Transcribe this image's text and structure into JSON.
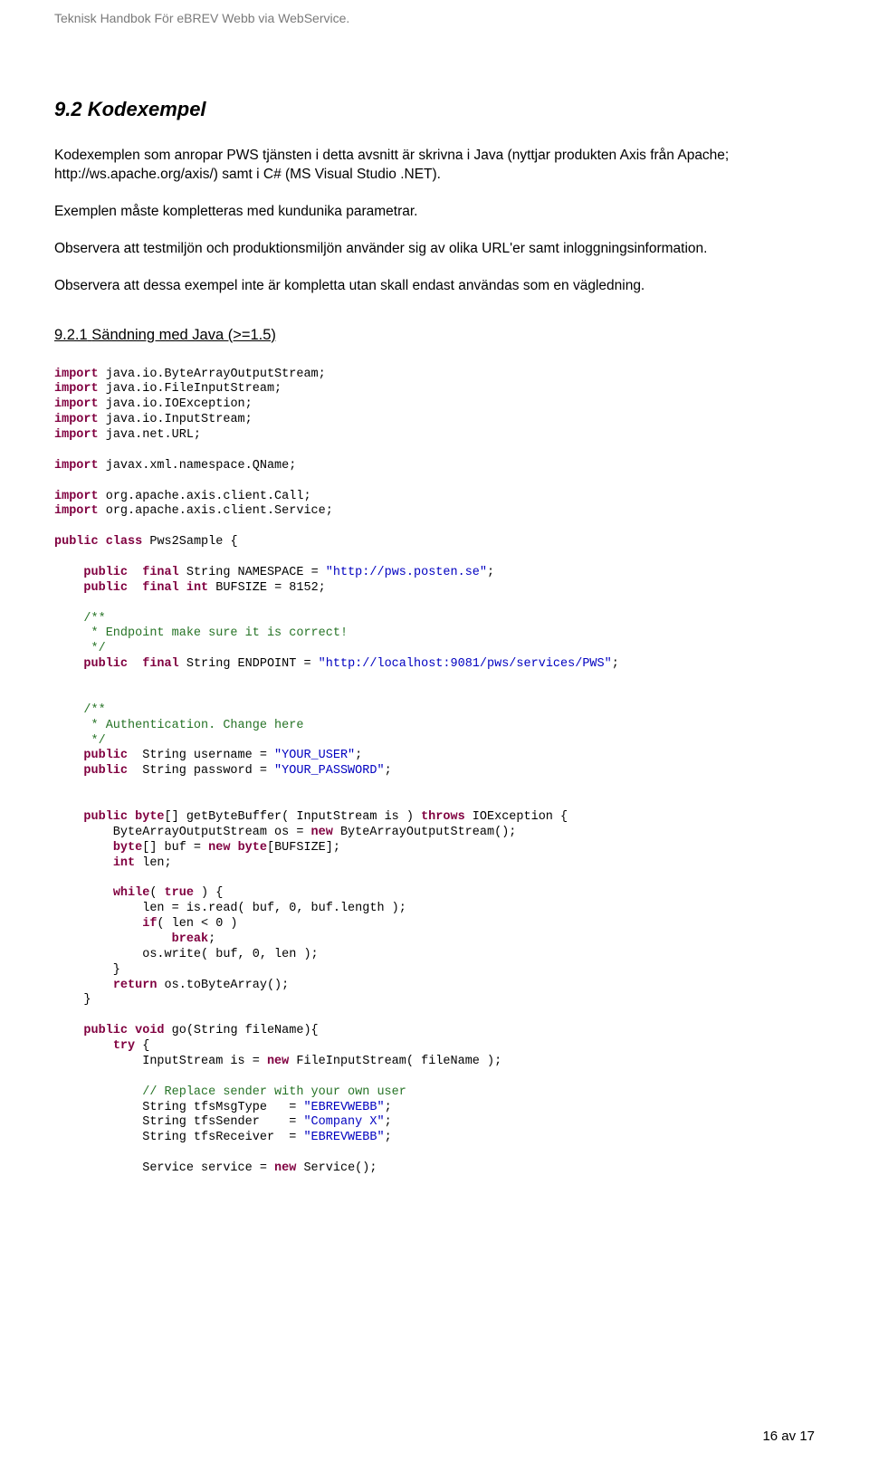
{
  "header": "Teknisk Handbok För eBREV Webb via WebService.",
  "section": {
    "number": "9.2",
    "title": "Kodexempel",
    "p1": "Kodexemplen som anropar PWS tjänsten i detta avsnitt är skrivna i Java (nyttjar produkten Axis från Apache; http://ws.apache.org/axis/) samt i C# (MS Visual Studio .NET).",
    "p2": "Exemplen måste kompletteras med kundunika parametrar.",
    "p3": "Observera att testmiljön och produktionsmiljön använder sig av olika URL'er samt inloggningsinformation.",
    "p4": "Observera att dessa exempel inte är kompletta utan skall endast användas som en vägledning."
  },
  "subsection": {
    "number": "9.2.1",
    "title": "Sändning med Java (>=1.5)"
  },
  "code": {
    "imports1": [
      "java.io.ByteArrayOutputStream;",
      "java.io.FileInputStream;",
      "java.io.IOException;",
      "java.io.InputStream;",
      "java.net.URL;"
    ],
    "imports2": "javax.xml.namespace.QName;",
    "imports3": [
      "org.apache.axis.client.Call;",
      "org.apache.axis.client.Service;"
    ],
    "class_name": "Pws2Sample",
    "ns_field1a": "String NAMESPACE = ",
    "ns_field1b": "\"http://pws.posten.se\"",
    "ns_field1c": ";",
    "ns_field2": "BUFSIZE = 8152;",
    "c1a": "/**",
    "c1b": " * Endpoint make sure it is correct!",
    "c1c": " */",
    "endpoint_a": "String ENDPOINT = ",
    "endpoint_b": "\"http://localhost:9081/pws/services/PWS\"",
    "endpoint_c": ";",
    "c2a": "/**",
    "c2b": " * Authentication. Change here",
    "c2c": " */",
    "user_a": "String username = ",
    "user_b": "\"YOUR_USER\"",
    "user_c": ";",
    "pass_a": "String password = ",
    "pass_b": "\"YOUR_PASSWORD\"",
    "pass_c": ";",
    "m1_sig_a": "[] getByteBuffer( InputStream is ) ",
    "m1_sig_b": "IOException {",
    "m1_l1a": "        ByteArrayOutputStream os = ",
    "m1_l1b": " ByteArrayOutputStream();",
    "m1_l2a": "[] buf = ",
    "m1_l2b": "[BUFSIZE];",
    "m1_l3": " len;",
    "m1_l4": " ) {",
    "m1_l5": "            len = is.read( buf, 0, buf.length );",
    "m1_l6": "( len < 0 )",
    "m1_l8": "            os.write( buf, 0, len );",
    "m1_l9": "        }",
    "m1_l10": " os.toByteArray();",
    "m1_l11": "    }",
    "m2_sig": " go(String fileName){",
    "m2_l1": " {",
    "m2_l2a": "            InputStream is = ",
    "m2_l2b": " FileInputStream( fileName );",
    "m2_c1": "// Replace sender with your own user",
    "m2_l3a": "            String tfsMsgType   = ",
    "m2_l3b": "\"EBREVWEBB\"",
    "m2_l4a": "            String tfsSender    = ",
    "m2_l4b": "\"Company X\"",
    "m2_l5a": "            String tfsReceiver  = ",
    "m2_l5b": "\"EBREVWEBB\"",
    "m2_end": ";",
    "m2_l6a": "            Service service = ",
    "m2_l6b": " Service();"
  },
  "kw": {
    "import": "import",
    "public": "public",
    "class": "class",
    "final": "final",
    "int": "int",
    "byte": "byte",
    "throws": "throws",
    "new": "new",
    "while": "while",
    "true": "true",
    "if": "if",
    "break": "break",
    "return": "return",
    "void": "void",
    "try": "try"
  },
  "pageNum": "16 av 17"
}
